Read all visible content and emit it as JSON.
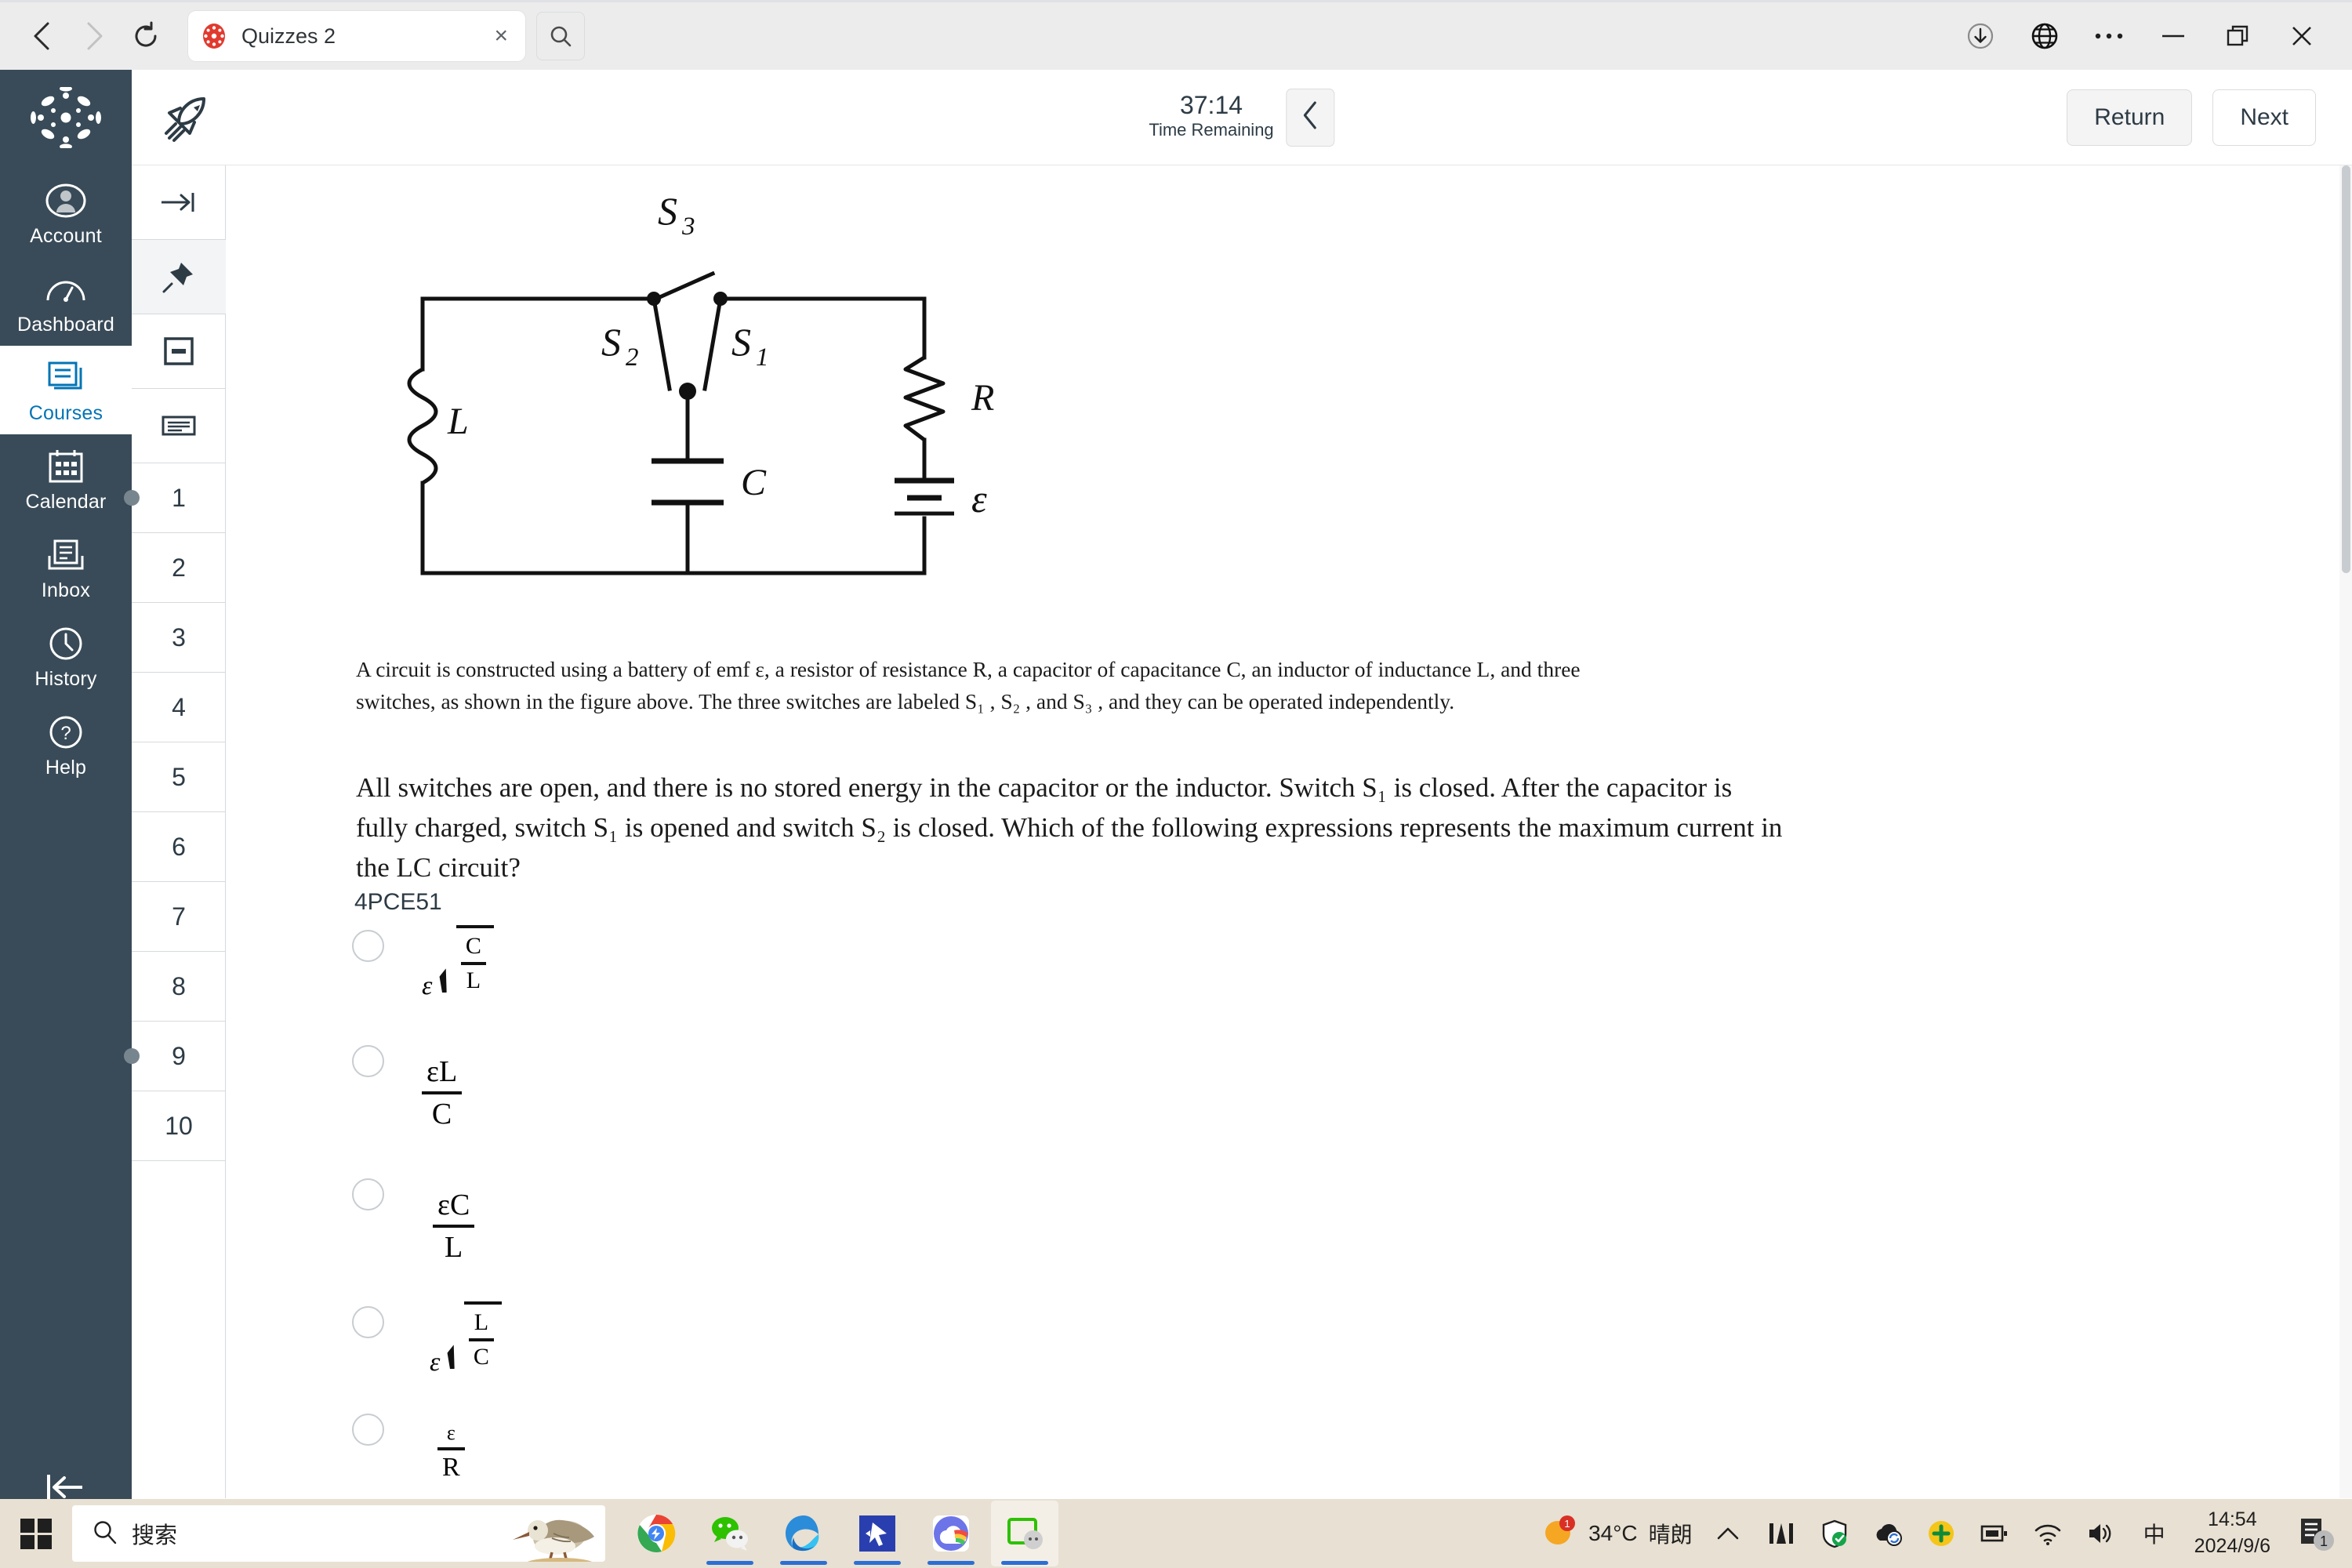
{
  "browser": {
    "back_icon": "back-arrow-icon",
    "forward_icon": "forward-arrow-icon",
    "reload_icon": "reload-icon",
    "tab_title": "Quizzes 2",
    "tab_close_label": "×",
    "tab_search_icon": "search-icon",
    "right_icons": [
      "download-icon",
      "translate-globe-icon",
      "more-options-icon",
      "minimize-icon",
      "restore-icon",
      "close-icon"
    ]
  },
  "canvas_nav": {
    "logo": "canvas-logo-icon",
    "items": [
      {
        "label": "Account",
        "icon": "user-avatar-icon",
        "active": false
      },
      {
        "label": "Dashboard",
        "icon": "dashboard-gauge-icon",
        "active": false
      },
      {
        "label": "Courses",
        "icon": "courses-book-icon",
        "active": true
      },
      {
        "label": "Calendar",
        "icon": "calendar-icon",
        "active": false
      },
      {
        "label": "Inbox",
        "icon": "inbox-icon",
        "active": false
      },
      {
        "label": "History",
        "icon": "clock-icon",
        "active": false
      },
      {
        "label": "Help",
        "icon": "question-circle-icon",
        "active": false
      }
    ],
    "collapse_icon": "collapse-left-icon",
    "accent": "#0374B5",
    "background": "#394B58"
  },
  "quiz_header": {
    "logo_icon": "rocket-icon",
    "timer_value": "37:14",
    "timer_label": "Time Remaining",
    "timer_toggle_icon": "chevron-left-icon",
    "return_label": "Return",
    "next_label": "Next"
  },
  "question_nav": {
    "tools": [
      {
        "icon": "jump-to-end-icon",
        "shaded": false
      },
      {
        "icon": "pin-icon",
        "shaded": true
      },
      {
        "icon": "note-card-icon",
        "shaded": false
      },
      {
        "icon": "text-lines-icon",
        "shaded": false
      }
    ],
    "questions": [
      {
        "number": "1",
        "marked": true
      },
      {
        "number": "2",
        "marked": false
      },
      {
        "number": "3",
        "marked": false
      },
      {
        "number": "4",
        "marked": false
      },
      {
        "number": "5",
        "marked": false
      },
      {
        "number": "6",
        "marked": false
      },
      {
        "number": "7",
        "marked": false
      },
      {
        "number": "8",
        "marked": false
      },
      {
        "number": "9",
        "marked": true
      },
      {
        "number": "10",
        "marked": false
      }
    ]
  },
  "question": {
    "figure_labels": {
      "s1": "S",
      "s1_sub": "1",
      "s2": "S",
      "s2_sub": "2",
      "s3": "S",
      "s3_sub": "3",
      "inductor": "L",
      "capacitor": "C",
      "resistor": "R",
      "emf": "ε"
    },
    "stem": "A circuit is constructed using a battery of emf ε, a resistor of resistance R, a capacitor of capacitance C, an inductor of inductance L, and three switches, as shown in the figure above. The three switches are labeled S₁ , S₂ , and S₃ , and they can be operated independently.",
    "prompt": "All switches are open, and there is no stored energy in the capacitor or the inductor. Switch S₁ is closed. After the capacitor is fully charged, switch S₁ is opened and switch S₂ is closed. Which of the following expressions represents the maximum current in the LC circuit?",
    "code": "4PCE51",
    "choices": [
      {
        "id": "a",
        "type": "sqrt-frac",
        "coefficient": "ε",
        "numerator": "C",
        "denominator": "L",
        "selected": false,
        "text": "ε√(C/L)"
      },
      {
        "id": "b",
        "type": "frac",
        "numerator": "εL",
        "denominator": "C",
        "selected": false,
        "text": "εL/C"
      },
      {
        "id": "c",
        "type": "frac",
        "numerator": "εC",
        "denominator": "L",
        "selected": false,
        "text": "εC/L"
      },
      {
        "id": "d",
        "type": "sqrt-frac",
        "coefficient": "ε",
        "numerator": "L",
        "denominator": "C",
        "selected": false,
        "text": "ε√(L/C)"
      },
      {
        "id": "e",
        "type": "frac",
        "numerator": "ε",
        "denominator": "R",
        "selected": false,
        "text": "ε/R"
      }
    ]
  },
  "taskbar": {
    "start_icon": "windows-start-icon",
    "search_placeholder": "搜索",
    "search_icon": "search-icon",
    "bird_icon": "sandpiper-bird-icon",
    "apps": [
      {
        "icon": "google-chrome-icon",
        "running": false,
        "active": false
      },
      {
        "icon": "wechat-icon",
        "running": true,
        "active": false
      },
      {
        "icon": "microsoft-edge-icon",
        "running": true,
        "active": false
      },
      {
        "icon": "cursor-app-icon",
        "running": true,
        "active": false
      },
      {
        "icon": "weather-cloud-icon",
        "running": true,
        "active": false
      },
      {
        "icon": "wechat-devtools-icon",
        "running": true,
        "active": true
      }
    ],
    "weather_temp": "34°C",
    "weather_desc": "晴朗",
    "weather_badge": "1",
    "tray_icons": [
      "chevron-up-icon",
      "audio-mixer-icon",
      "security-shield-icon",
      "cloud-sync-icon",
      "plus-circle-icon",
      "battery-icon",
      "wifi-icon",
      "volume-icon",
      "ime-chinese-icon"
    ],
    "ime_label": "中",
    "clock_time": "14:54",
    "clock_date": "2024/9/6",
    "notification_badge": "1",
    "notification_icon": "notifications-icon"
  }
}
